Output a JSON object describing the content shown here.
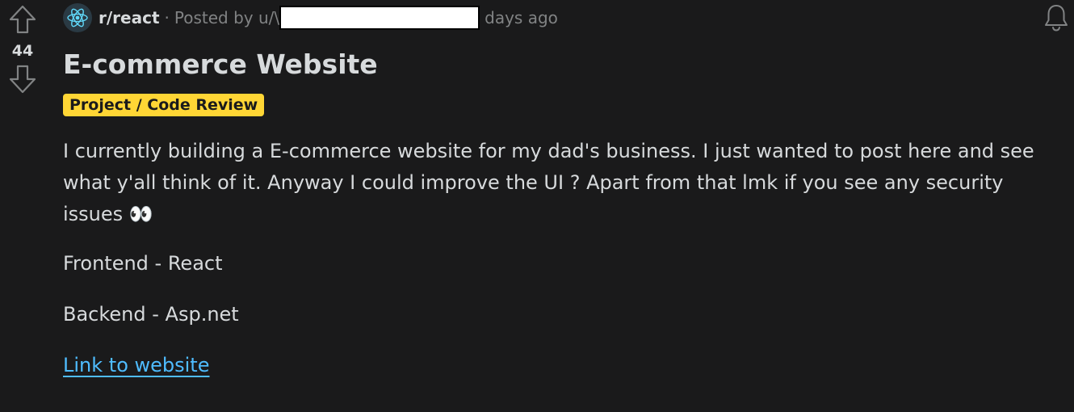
{
  "vote": {
    "count": "44",
    "up_icon": "arrow-up-icon",
    "down_icon": "arrow-down-icon"
  },
  "meta": {
    "subreddit": "r/react",
    "posted_by": "Posted by u/\\",
    "time_ago": "days ago",
    "subreddit_icon": "react-atom-icon",
    "bell_icon": "bell-icon"
  },
  "post": {
    "title": "E-commerce Website",
    "flair": "Project / Code Review",
    "body_paragraph_1": "I currently building a E-commerce website for my dad's business. I just wanted to post here and see what y'all think of it. Anyway I could improve the UI ? Apart from that lmk if you see any security issues 👀",
    "body_paragraph_2": "Frontend - React",
    "body_paragraph_3": "Backend - Asp.net",
    "link_text": "Link to website"
  },
  "colors": {
    "background": "#1a1a1b",
    "text": "#d7dadc",
    "muted": "#818384",
    "flair_bg": "#ffd635",
    "link": "#4fbcff"
  }
}
